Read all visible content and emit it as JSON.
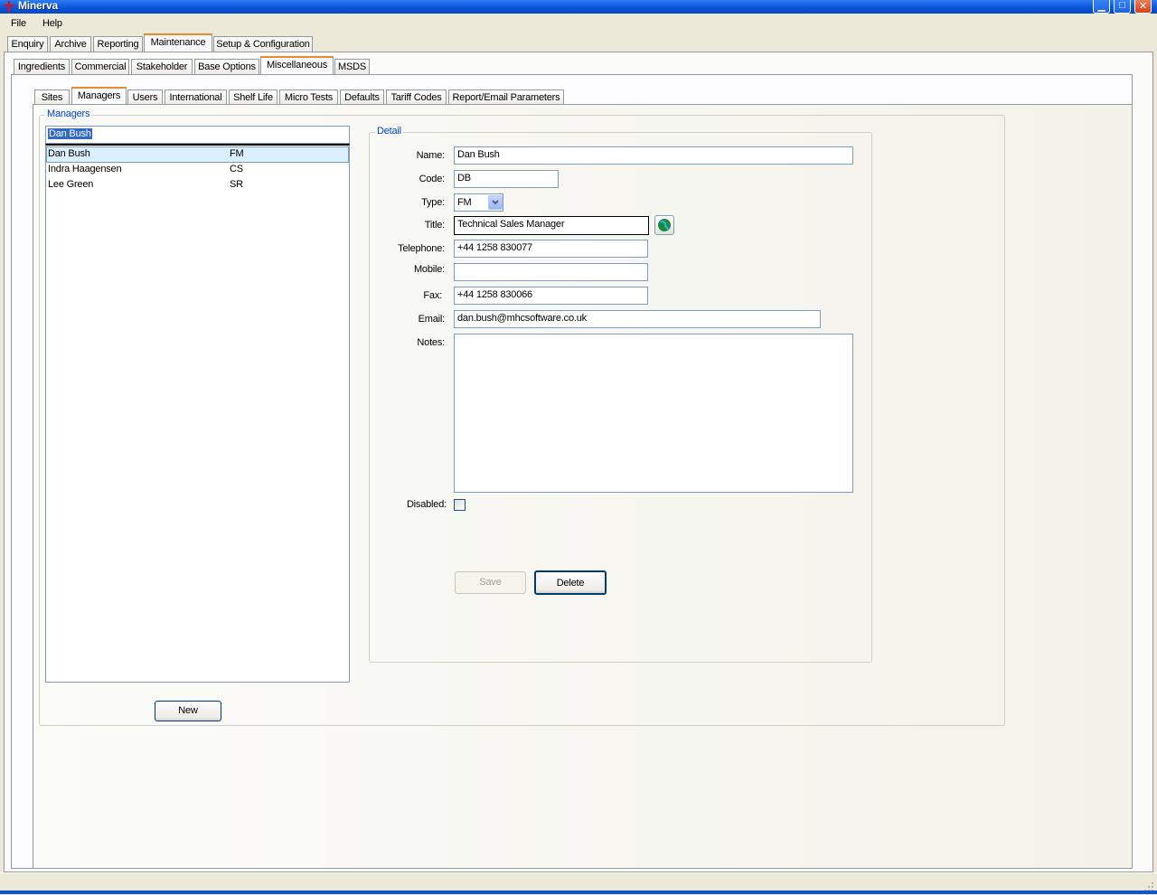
{
  "window": {
    "title": "Minerva"
  },
  "menu": [
    "File",
    "Help"
  ],
  "main_tabs": [
    "Enquiry",
    "Archive",
    "Reporting",
    "Maintenance",
    "Setup & Configuration"
  ],
  "sub_tabs": [
    "Ingredients",
    "Commercial",
    "Stakeholder",
    "Base Options",
    "Miscellaneous",
    "MSDS"
  ],
  "misc_tabs": [
    "Sites",
    "Managers",
    "Users",
    "International",
    "Shelf Life",
    "Micro Tests",
    "Defaults",
    "Tariff Codes",
    "Report/Email Parameters"
  ],
  "managers": {
    "caption": "Managers",
    "search_value": "Dan Bush",
    "rows": [
      {
        "name": "Dan Bush",
        "type": "FM"
      },
      {
        "name": "Indra Haagensen",
        "type": "CS"
      },
      {
        "name": "Lee Green",
        "type": "SR"
      }
    ],
    "selected_index": 0,
    "new_label": "New"
  },
  "detail": {
    "caption": "Detail",
    "labels": {
      "name": "Name:",
      "code": "Code:",
      "type": "Type:",
      "title": "Title:",
      "telephone": "Telephone:",
      "mobile": "Mobile:",
      "fax": "Fax:",
      "email": "Email:",
      "notes": "Notes:",
      "disabled": "Disabled:"
    },
    "values": {
      "name": "Dan Bush",
      "code": "DB",
      "type": "FM",
      "title": "Technical Sales Manager",
      "telephone": "+44 1258 830077",
      "mobile": "",
      "fax": "+44 1258 830066",
      "email": "dan.bush@mhcsoftware.co.uk",
      "notes": "",
      "disabled": false
    },
    "save_label": "Save",
    "delete_label": "Delete"
  },
  "colors": {
    "accent": "#e68b2c",
    "caption": "#0046d5",
    "titlebar": "#0a56d8"
  }
}
